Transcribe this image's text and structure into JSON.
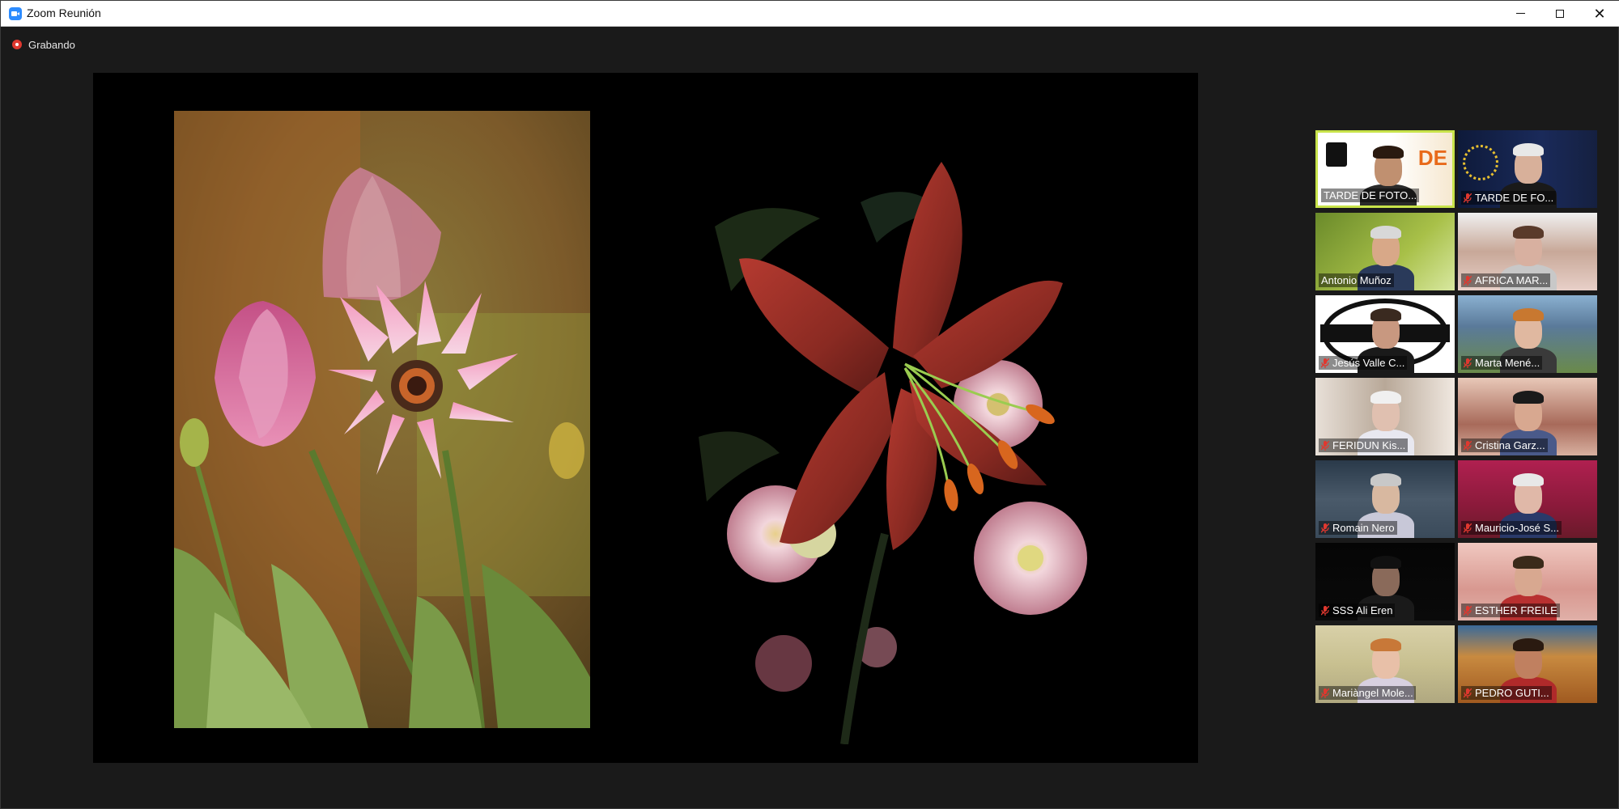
{
  "window": {
    "title": "Zoom Reunión",
    "minimize_label": "—",
    "maximize_label": "☐",
    "close_label": "✕"
  },
  "recording": {
    "label": "Grabando",
    "color": "#e0382f"
  },
  "shared_screen": {
    "background": "#000000"
  },
  "participants": [
    {
      "name": "TARDE DE FOTO...",
      "muted": false,
      "active_speaker": true
    },
    {
      "name": "TARDE DE FO...",
      "muted": true,
      "active_speaker": false
    },
    {
      "name": "Antonio Muñoz",
      "muted": false,
      "active_speaker": false
    },
    {
      "name": "AFRICA MAR...",
      "muted": true,
      "active_speaker": false
    },
    {
      "name": "Jesús Valle C...",
      "muted": true,
      "active_speaker": false
    },
    {
      "name": "Marta Mené...",
      "muted": true,
      "active_speaker": false
    },
    {
      "name": "FERIDUN Kis...",
      "muted": true,
      "active_speaker": false
    },
    {
      "name": "Cristina Garz...",
      "muted": true,
      "active_speaker": false
    },
    {
      "name": "Romain Nero",
      "muted": true,
      "active_speaker": false
    },
    {
      "name": "Mauricio-José S...",
      "muted": true,
      "active_speaker": false
    },
    {
      "name": "SSS Ali Eren",
      "muted": true,
      "active_speaker": false
    },
    {
      "name": "ESTHER FREILE",
      "muted": true,
      "active_speaker": false
    },
    {
      "name": "Mariàngel Mole...",
      "muted": true,
      "active_speaker": false
    },
    {
      "name": "PEDRO GUTI...",
      "muted": true,
      "active_speaker": false
    }
  ],
  "colors": {
    "accent_active": "#c8e34a",
    "mic_off": "#e0382f",
    "meeting_bg": "#1a1a1a"
  }
}
